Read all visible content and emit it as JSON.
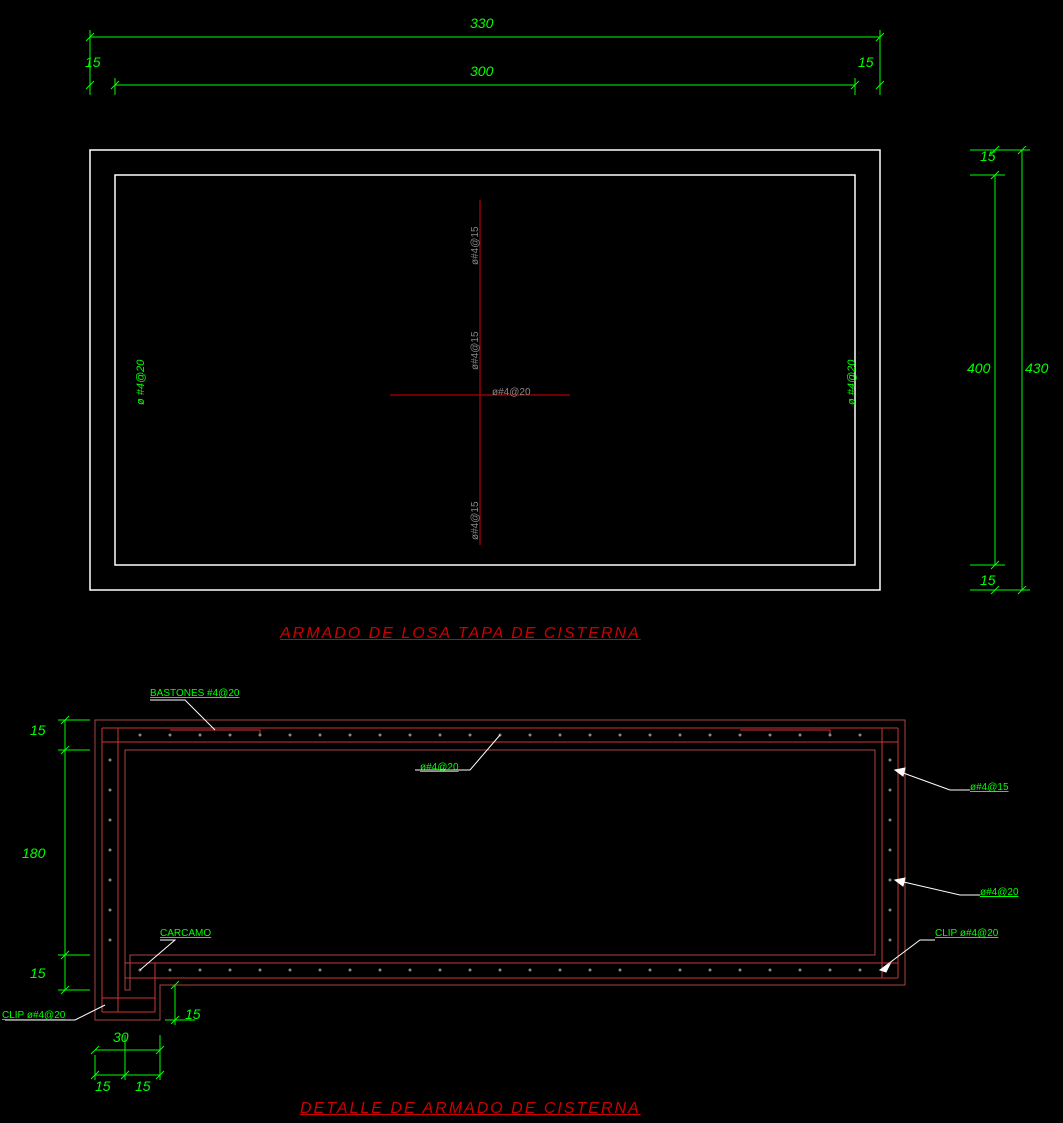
{
  "dimensions": {
    "top_outer": "330",
    "top_inner": "300",
    "top_left_offset": "15",
    "top_right_offset": "15",
    "right_outer": "430",
    "right_inner": "400",
    "right_top_offset": "15",
    "right_bottom_offset": "15",
    "section_top": "15",
    "section_mid": "180",
    "section_bot": "15",
    "section_sump_h": "15",
    "section_sump_w1": "30",
    "section_sump_w2": "15",
    "section_sump_w3": "15"
  },
  "rebar": {
    "plan_left": "ø #4@20",
    "plan_right": "ø #4@20",
    "plan_center_h": "ø#4@20",
    "plan_center_v1": "ø#4@15",
    "plan_center_v2": "ø#4@15",
    "plan_center_v3": "ø#4@15"
  },
  "annotations": {
    "bastones": "BASTONES #4@20",
    "carcamo": "CARCAMO",
    "clip_bl": "CLIP ø#4@20",
    "section_top_rebar": "ø#4@20",
    "section_right_1": "ø#4@15",
    "section_right_2": "ø#4@20",
    "section_right_3": "CLIP ø#4@20"
  },
  "titles": {
    "plan": "ARMADO DE LOSA TAPA DE CISTERNA",
    "section": "DETALLE DE ARMADO DE CISTERNA"
  }
}
